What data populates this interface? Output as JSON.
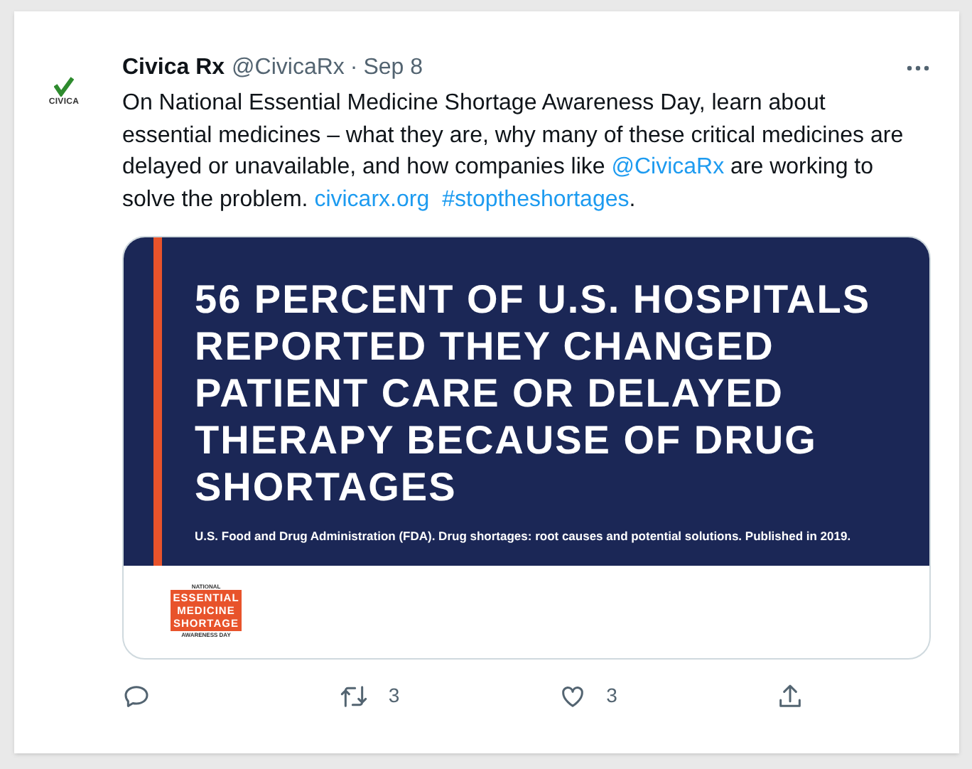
{
  "tweet": {
    "author": {
      "name": "Civica Rx",
      "handle": "@CivicaRx",
      "separator": "·",
      "time": "Sep 8",
      "avatar_label": "CIVICA"
    },
    "body": [
      {
        "kind": "text",
        "text": "On National Essential Medicine Shortage Awareness Day, learn about essential medicines – what they are, why many of these critical medicines are delayed or unavailable, and how companies like "
      },
      {
        "kind": "mention",
        "text": "@CivicaRx"
      },
      {
        "kind": "text",
        "text": " are working to solve the problem. "
      },
      {
        "kind": "link",
        "text": "civicarx.org"
      },
      {
        "kind": "hashtag",
        "text": "#stoptheshortages"
      },
      {
        "kind": "text",
        "text": "."
      }
    ],
    "media": {
      "heading": "56 PERCENT OF U.S. HOSPITALS REPORTED THEY CHANGED PATIENT CARE OR DELAYED THERAPY BECAUSE OF DRUG SHORTAGES",
      "caption": "U.S. Food and Drug Administration (FDA). Drug shortages: root causes and potential solutions. Published in 2019.",
      "logo": {
        "top": "NATIONAL",
        "lines": [
          "ESSENTIAL",
          "MEDICINE",
          "SHORTAGE"
        ],
        "bottom": "AWARENESS DAY"
      }
    },
    "actions": [
      {
        "kind": "reply"
      },
      {
        "kind": "retweet",
        "count": "3"
      },
      {
        "kind": "like",
        "count": "3"
      },
      {
        "kind": "share"
      }
    ]
  }
}
